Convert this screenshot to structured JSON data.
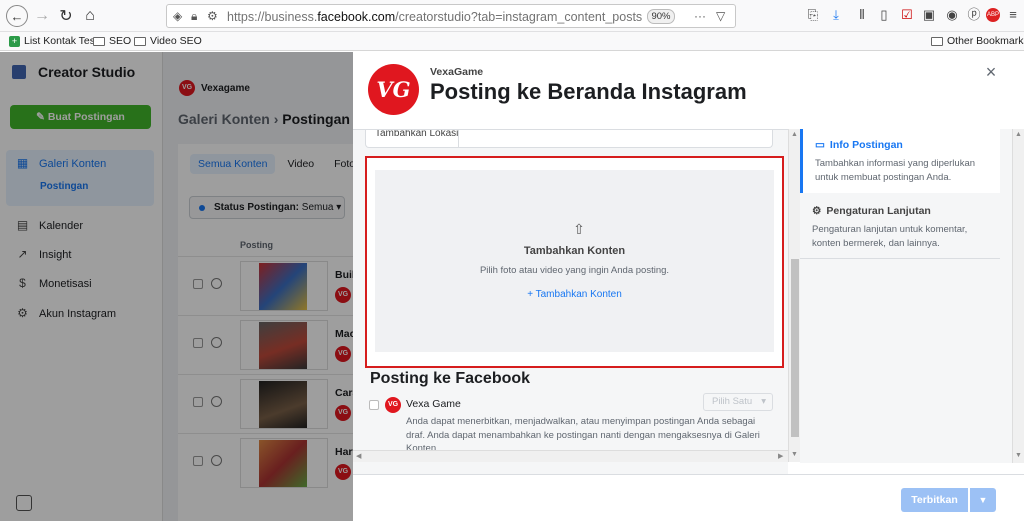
{
  "browser": {
    "url_prefix": "https://business.",
    "url_domain": "facebook.com",
    "url_suffix": "/creatorstudio?tab=instagram_content_posts",
    "zoom": "90%",
    "bookmarks": [
      "List Kontak Test",
      "SEO",
      "Video SEO"
    ],
    "other_bookmarks": "Other Bookmarks"
  },
  "sidebar": {
    "title": "Creator Studio",
    "create_button": "Buat Postingan",
    "items": [
      {
        "label": "Galeri Konten",
        "icon": "gallery-icon"
      },
      {
        "label": "Kalender",
        "icon": "calendar-icon"
      },
      {
        "label": "Insight",
        "icon": "insight-icon"
      },
      {
        "label": "Monetisasi",
        "icon": "dollar-icon"
      },
      {
        "label": "Akun Instagram",
        "icon": "gear-icon"
      }
    ],
    "subitem": "Postingan"
  },
  "content": {
    "account": "Vexagame",
    "breadcrumb_parent": "Galeri Konten",
    "breadcrumb_current": "Postingan",
    "tabs": [
      "Semua Konten",
      "Video",
      "Foto"
    ],
    "status_label": "Status Postingan:",
    "status_value": "Semua",
    "column_post": "Posting",
    "rows": [
      "Build",
      "Mac",
      "Cara",
      "Harv"
    ]
  },
  "modal": {
    "account": "VexaGame",
    "logo": "VG",
    "title": "Posting ke Beranda Instagram",
    "location_label": "Tambahkan Lokasi",
    "dropzone": {
      "title": "Tambahkan Konten",
      "subtitle": "Pilih foto atau video yang ingin Anda posting.",
      "link": "+ Tambahkan Konten"
    },
    "fb_section_title": "Posting ke Facebook",
    "fb_page_name": "Vexa Game",
    "fb_pick": "Pilih Satu",
    "fb_description": "Anda dapat menerbitkan, menjadwalkan, atau menyimpan postingan Anda sebagai draf. Anda dapat menambahkan ke postingan nanti dengan mengaksesnya di Galeri Konten.",
    "right_panel": [
      {
        "title": "Info Postingan",
        "desc": "Tambahkan informasi yang diperlukan untuk membuat postingan Anda."
      },
      {
        "title": "Pengaturan Lanjutan",
        "desc": "Pengaturan lanjutan untuk komentar, konten bermerek, dan lainnya."
      }
    ],
    "publish_button": "Terbitkan",
    "colors": {
      "highlight_border": "#d61d1d",
      "accent": "#1877f2",
      "publish_disabled": "#9cc1f5",
      "brand_red": "#e0171f"
    }
  }
}
